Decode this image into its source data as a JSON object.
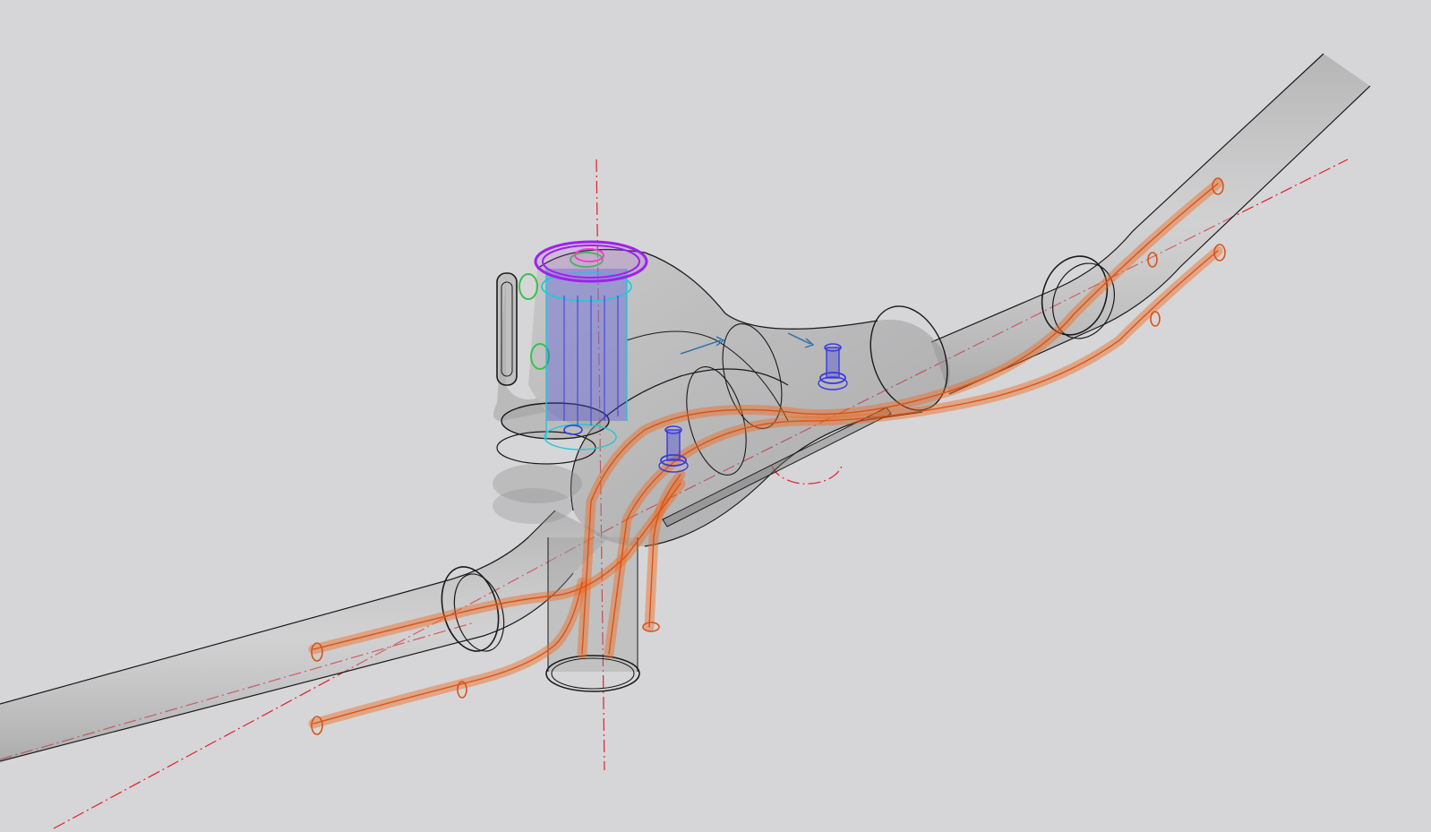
{
  "viewport": {
    "background": "#d6d6d8"
  },
  "palette": {
    "body_fill": "#8c8c8c",
    "body_edge": "#1a1a1a",
    "cable": "#f06a1e",
    "cable_dark": "#d9531a",
    "centerline": "#e0202a",
    "bolt": "#3a3adf",
    "cap": "#a020f0",
    "cyan": "#22c8d8",
    "green": "#3ac24a",
    "pink": "#ff33cc",
    "arrow": "#2a6ea8"
  },
  "parts": [
    "handlebar-tube-left-icon",
    "handlebar-tube-right-icon",
    "stem-body-icon",
    "steerer-clamp-icon",
    "top-cap-icon",
    "internal-cable-icon",
    "mounting-bolt-icon",
    "centerline-axis-icon"
  ]
}
